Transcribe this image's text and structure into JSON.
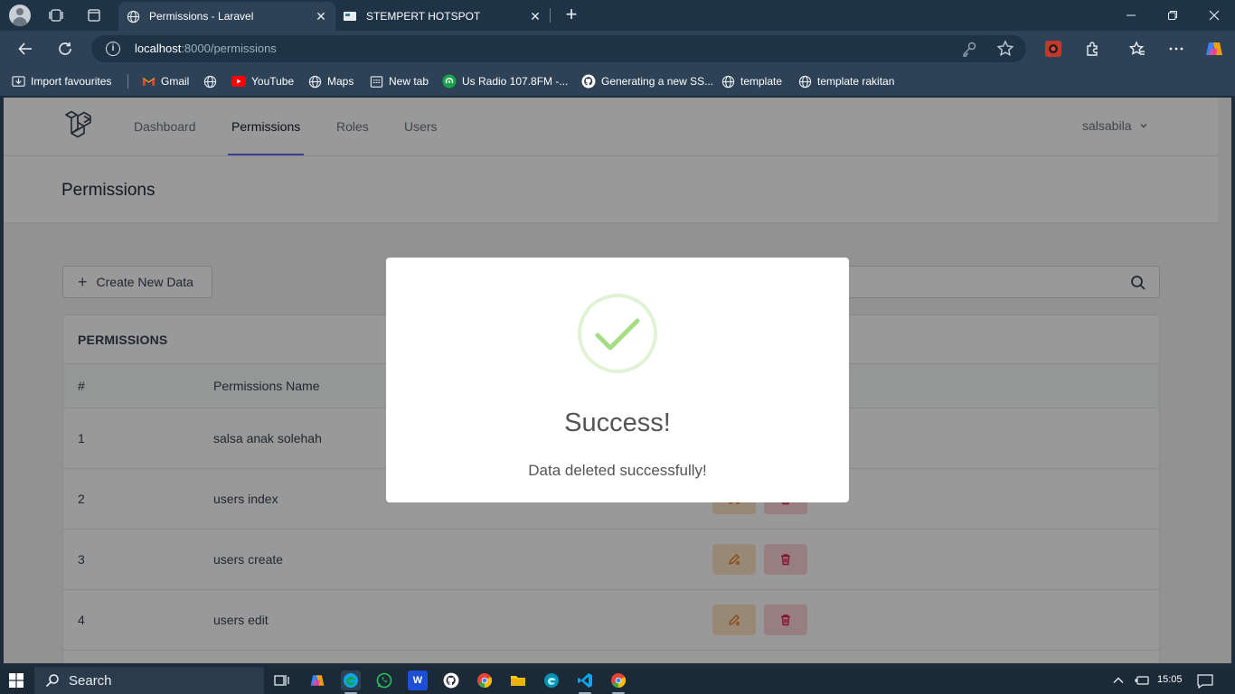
{
  "browser": {
    "tabs": [
      {
        "title": "Permissions - Laravel",
        "active": true
      },
      {
        "title": "STEMPERT HOTSPOT",
        "active": false
      }
    ],
    "address": {
      "host": "localhost",
      "path": ":8000/permissions"
    },
    "bookmarks": [
      {
        "label": "Import favourites",
        "icon": "import-icon"
      },
      {
        "label": "Gmail",
        "icon": "gmail-icon"
      },
      {
        "label": "",
        "icon": "globe-icon"
      },
      {
        "label": "YouTube",
        "icon": "youtube-icon"
      },
      {
        "label": "Maps",
        "icon": "globe-icon"
      },
      {
        "label": "New tab",
        "icon": "newtab-icon"
      },
      {
        "label": "Us Radio 107.8FM -...",
        "icon": "radio-icon"
      },
      {
        "label": "Generating a new SS...",
        "icon": "github-icon"
      },
      {
        "label": "template",
        "icon": "globe-icon"
      },
      {
        "label": "template rakitan",
        "icon": "globe-icon"
      }
    ]
  },
  "app": {
    "nav": {
      "links": [
        "Dashboard",
        "Permissions",
        "Roles",
        "Users"
      ],
      "active": "Permissions",
      "user": "salsabila"
    },
    "header_title": "Permissions",
    "create_button": "Create New Data",
    "card_title": "PERMISSIONS",
    "table": {
      "columns": [
        "#",
        "Permissions Name"
      ],
      "rows": [
        {
          "no": "1",
          "name": "salsa anak solehah"
        },
        {
          "no": "2",
          "name": "users index"
        },
        {
          "no": "3",
          "name": "users create"
        },
        {
          "no": "4",
          "name": "users edit"
        }
      ]
    }
  },
  "modal": {
    "title": "Success!",
    "message": "Data deleted successfully!",
    "icon": "success-check-icon",
    "accent": "#a5dc86"
  },
  "taskbar": {
    "search_label": "Search",
    "time": "15:05"
  },
  "colors": {
    "nav_active_underline": "#6366f1",
    "edit_button": "#fde5c6",
    "delete_button": "#fcd3d7"
  }
}
